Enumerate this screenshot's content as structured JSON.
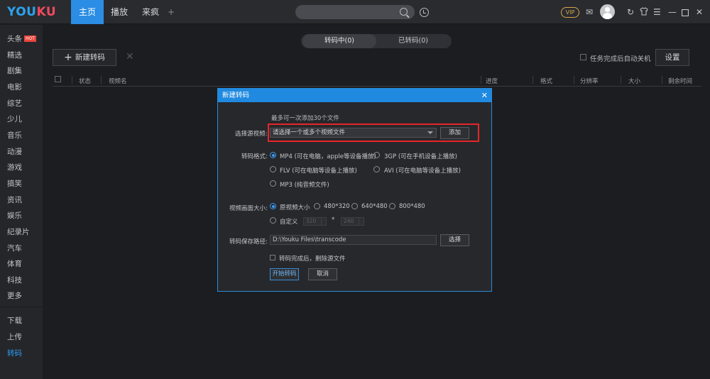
{
  "app": {
    "logo_left": "YOU",
    "logo_right": "KU"
  },
  "nav": {
    "tabs": [
      "主页",
      "播放",
      "来疯"
    ],
    "plus": "+"
  },
  "topbar": {
    "vip": "VIP"
  },
  "sidebar": {
    "hot_badge": "HOT",
    "items": [
      "头条",
      "精选",
      "剧集",
      "电影",
      "综艺",
      "少儿",
      "音乐",
      "动漫",
      "游戏",
      "搞笑",
      "资讯",
      "娱乐",
      "纪录片",
      "汽车",
      "体育",
      "科技",
      "更多",
      "下载",
      "上传",
      "转码"
    ],
    "active": "转码"
  },
  "transcode": {
    "tab_in_progress": "转码中(0)",
    "tab_done": "已转码(0)",
    "new_button": "新建转码",
    "auto_shutdown_label": "任务完成后自动关机",
    "settings_button": "设置",
    "columns": [
      "状态",
      "视频名",
      "进度",
      "格式",
      "分辨率",
      "大小",
      "剩余时间"
    ]
  },
  "dialog": {
    "title": "新建转码",
    "hint": "最多可一次添加30个文件",
    "source_label": "选择源视频:",
    "source_placeholder": "请选择一个或多个视频文件",
    "add_button": "添加",
    "format_label": "转码格式:",
    "formats": [
      {
        "label": "MP4 (可在电脑，apple等设备播放)",
        "selected": true
      },
      {
        "label": "3GP (可在手机设备上播放)",
        "selected": false
      },
      {
        "label": "FLV (可在电脑等设备上播放)",
        "selected": false
      },
      {
        "label": "AVI (可在电脑等设备上播放)",
        "selected": false
      },
      {
        "label": "MP3 (纯音频文件)",
        "selected": false
      }
    ],
    "size_label": "视频画面大小:",
    "sizes": [
      {
        "label": "原视频大小",
        "selected": true
      },
      {
        "label": "480*320",
        "selected": false
      },
      {
        "label": "640*480",
        "selected": false
      },
      {
        "label": "800*480",
        "selected": false
      },
      {
        "label": "自定义",
        "selected": false
      }
    ],
    "custom_width": "320",
    "custom_sep": "*",
    "custom_height": "240",
    "path_label": "转码保存路径:",
    "path_value": "D:\\Youku Files\\transcode",
    "browse_button": "选择",
    "delete_source_label": "转码完成后，删除源文件",
    "start_button": "开始转码",
    "cancel_button": "取消"
  },
  "colors": {
    "accent": "#2b8de4",
    "highlight": "#e5262a",
    "background": "#1c1d21"
  }
}
